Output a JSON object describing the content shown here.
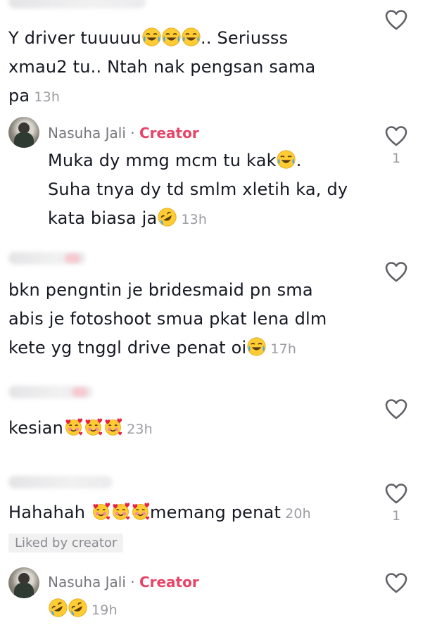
{
  "comments": [
    {
      "text_parts": [
        "Y driver tuuuuu",
        "..  Seriusss xmau2 tu.. Ntah nak pengsan sama pa"
      ],
      "time": "13h"
    },
    {
      "author": "Nasuha Jali",
      "badge": "Creator",
      "separator": "·",
      "line1": "Muka dy mmg mcm tu kak",
      "line1_end": ".",
      "line2": "Suha tnya dy td smlm xletih ka, dy",
      "line3": "kata biasa ja",
      "time": "13h",
      "likes": "1"
    },
    {
      "line1": "bkn pengntin je bridesmaid pn sma",
      "line2": "abis je fotoshoot smua pkat lena dlm",
      "line3": "kete yg tnggl drive penat oi",
      "time": "17h"
    },
    {
      "text": "kesian",
      "time": "23h"
    },
    {
      "text_start": "Hahahah ",
      "text_end": "memang penat",
      "time": "20h",
      "likes": "1",
      "liked_label": "Liked by creator"
    },
    {
      "author": "Nasuha Jali",
      "badge": "Creator",
      "separator": "·",
      "time": "19h"
    }
  ],
  "icons": {
    "like": "heart-outline-icon",
    "laugh": "face-with-tears-of-joy-icon",
    "rofl": "rolling-on-floor-laughing-icon",
    "hearts": "smiling-face-with-hearts-icon"
  },
  "colors": {
    "creator": "#e64467",
    "muted": "#9b9ba1",
    "text": "#161823"
  }
}
